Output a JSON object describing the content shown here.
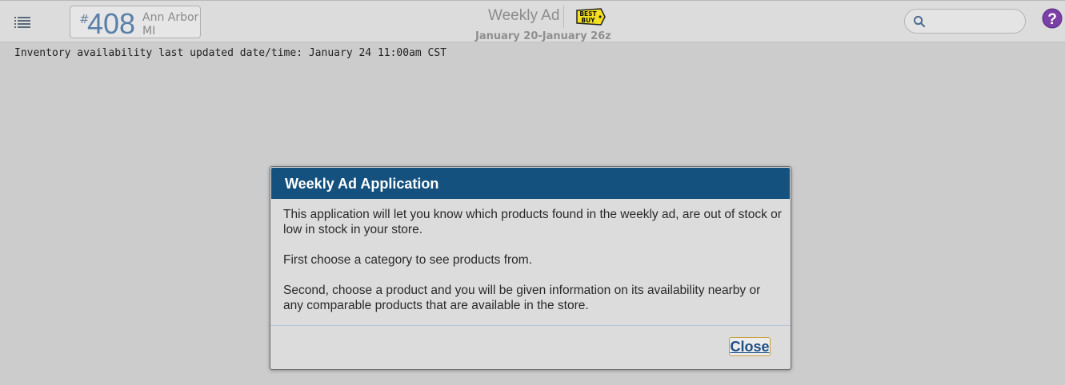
{
  "header": {
    "menu_icon": "list-icon",
    "store": {
      "hash": "#",
      "number": "408",
      "city": "Ann Arbor",
      "state": "MI"
    },
    "title": "Weekly Ad",
    "logo_text": "BEST BUY",
    "dates": "January 20-January 26z",
    "search": {
      "placeholder": "",
      "value": "",
      "icon": "search-icon"
    },
    "help_icon": "help-icon"
  },
  "inventory_note": "Inventory availability last updated date/time: January 24 11:00am CST",
  "dialog": {
    "title": "Weekly Ad Application",
    "paragraphs": [
      "This application will let you know which products found in the weekly ad, are out of stock or low in stock in your store.",
      "First choose a category to see products from.",
      "Second, choose a product and you will be given information on its availability nearby or any comparable products that are available in the store."
    ],
    "close_label": "Close"
  },
  "colors": {
    "header_bar": "#dcdcdc",
    "page_bg": "#cccccc",
    "dialog_header": "#14517e",
    "store_number": "#5b7fa8",
    "help_purple": "#7b3fa8",
    "logo_yellow": "#f5e020"
  }
}
